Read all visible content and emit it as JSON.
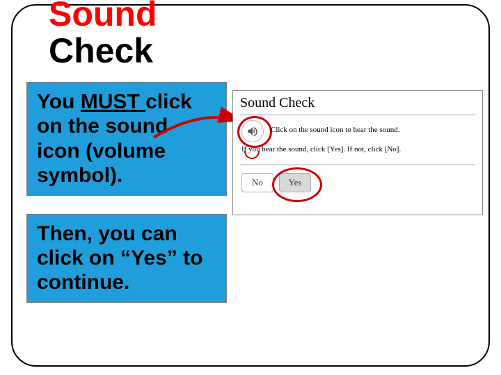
{
  "title": {
    "line1": "Sound",
    "line2": "Check"
  },
  "instructions": {
    "part1_pre": "You ",
    "part1_must": "MUST ",
    "part1_post": "click on the sound icon (volume symbol).",
    "part2": "Then, you can click on “Yes” to continue."
  },
  "panel": {
    "title": "Sound Check",
    "line1": "Click on the sound icon to hear the sound.",
    "line2": "If you hear the sound, click [Yes]. If not, click [No].",
    "no_label": "No",
    "yes_label": "Yes"
  },
  "colors": {
    "accent_red": "#ff0000",
    "callout_red": "#cc0000",
    "box_blue": "#1f9edb"
  }
}
